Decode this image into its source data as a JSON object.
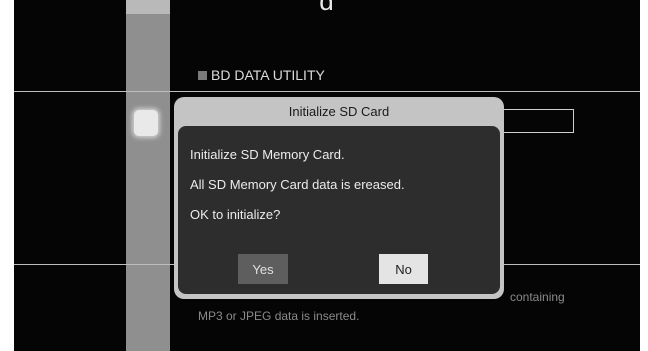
{
  "top_title": "d",
  "section": {
    "title": "BD DATA UTILITY"
  },
  "background_text": {
    "right_fragment": "containing",
    "left_fragment": "MP3 or JPEG data is inserted."
  },
  "dialog": {
    "title": "Initialize SD Card",
    "messages": [
      "Initialize SD Memory Card.",
      "All SD Memory Card data is ereased.",
      "OK to initialize?"
    ],
    "yes_label": "Yes",
    "no_label": "No",
    "focused_button": "No"
  },
  "colors": {
    "screen_bg": "#050505",
    "dialog_frame": "#c4c4c4",
    "dialog_body": "#2d2d2d",
    "button_unfocused": "#5e5e5e",
    "button_focused": "#e4e4e4"
  }
}
